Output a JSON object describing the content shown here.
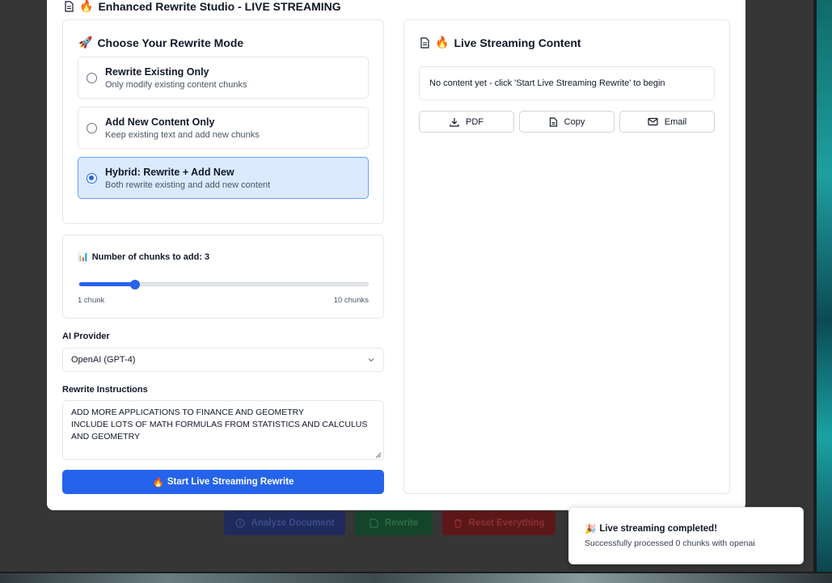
{
  "dialog": {
    "title": "Enhanced Rewrite Studio - LIVE STREAMING",
    "title_emoji": "🔥"
  },
  "mode_panel": {
    "heading": "Choose Your Rewrite Mode",
    "heading_emoji": "🚀",
    "options": [
      {
        "title": "Rewrite Existing Only",
        "desc": "Only modify existing content chunks",
        "selected": false
      },
      {
        "title": "Add New Content Only",
        "desc": "Keep existing text and add new chunks",
        "selected": false
      },
      {
        "title": "Hybrid: Rewrite + Add New",
        "desc": "Both rewrite existing and add new content",
        "selected": true
      }
    ]
  },
  "chunks": {
    "label": "Number of chunks to add: 3",
    "label_emoji": "📊",
    "value": 3,
    "min": 1,
    "max": 10,
    "min_label": "1 chunk",
    "max_label": "10 chunks"
  },
  "provider": {
    "label": "AI Provider",
    "value": "OpenAI (GPT-4)"
  },
  "instructions": {
    "label": "Rewrite Instructions",
    "value": "ADD MORE APPLICATIONS TO FINANCE AND GEOMETRY\nINCLUDE LOTS OF MATH FORMULAS FROM STATISTICS AND CALCULUS AND GEOMETRY"
  },
  "start_button": {
    "label": "Start Live Streaming Rewrite",
    "emoji": "🔥"
  },
  "live_panel": {
    "heading": "Live Streaming Content",
    "heading_emoji": "🔥",
    "content": "No content yet - click 'Start Live Streaming Rewrite' to begin",
    "buttons": {
      "pdf": "PDF",
      "copy": "Copy",
      "email": "Email"
    }
  },
  "background_buttons": {
    "analyze": "Analyze Document",
    "rewrite": "Rewrite",
    "reset": "Reset Everything"
  },
  "toast": {
    "title": "Live streaming completed!",
    "emoji": "🎉",
    "description": "Successfully processed 0 chunks with openai"
  },
  "colors": {
    "primary": "#2563eb",
    "selected_bg": "#dbeafe",
    "backdrop": "#363636"
  }
}
